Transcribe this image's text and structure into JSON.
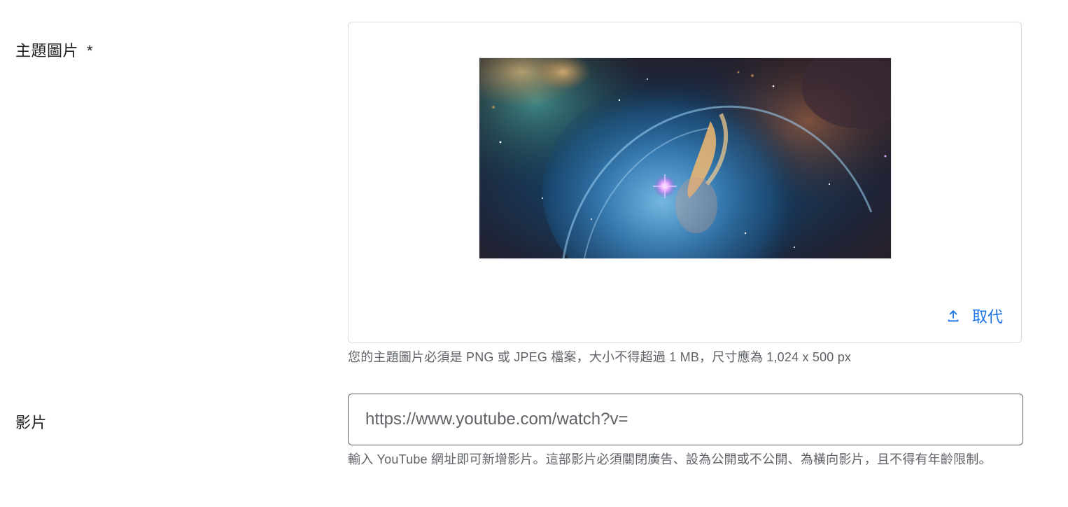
{
  "feature_image": {
    "label": "主題圖片",
    "required_marker": "*",
    "replace_label": "取代",
    "replace_icon": "upload-icon",
    "helper_text": "您的主題圖片必須是 PNG 或 JPEG 檔案，大小不得超過 1 MB，尺寸應為 1,024 x 500 px"
  },
  "video": {
    "label": "影片",
    "placeholder": "https://www.youtube.com/watch?v=",
    "value": "",
    "helper_text": "輸入 YouTube 網址即可新增影片。這部影片必須關閉廣告、設為公開或不公開、為橫向影片，且不得有年齡限制。"
  },
  "colors": {
    "accent": "#1a73e8",
    "border": "#dadce0",
    "text": "#202124",
    "secondary_text": "#5f6368"
  }
}
